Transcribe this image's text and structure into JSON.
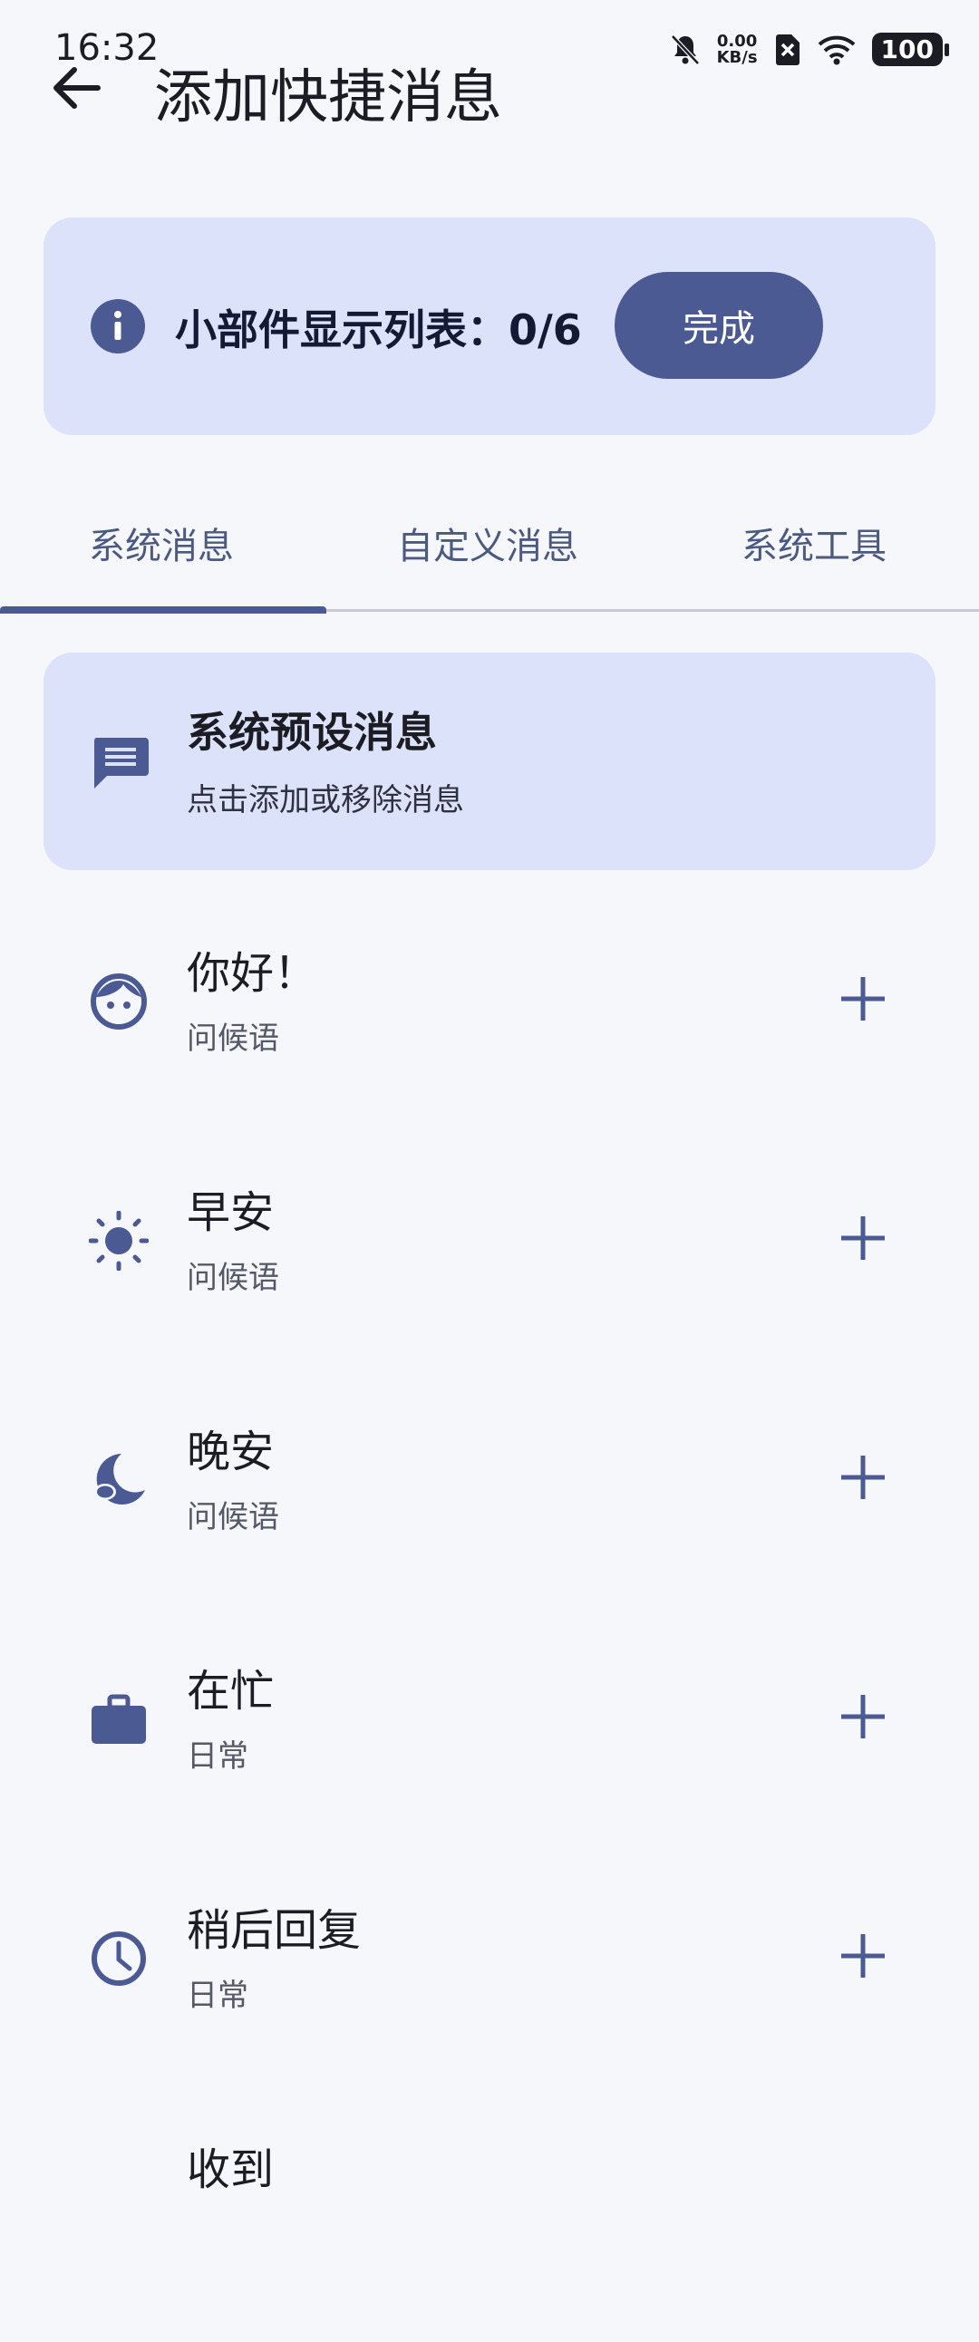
{
  "status_bar": {
    "time": "16:32",
    "net_speed_value": "0.00",
    "net_speed_unit": "KB/s",
    "battery": "100"
  },
  "app_bar": {
    "title": "添加快捷消息"
  },
  "widget_card": {
    "count_text": "小部件显示列表：0/6",
    "done_label": "完成"
  },
  "tabs": [
    {
      "label": "系统消息",
      "active": true
    },
    {
      "label": "自定义消息",
      "active": false
    },
    {
      "label": "系统工具",
      "active": false
    }
  ],
  "section": {
    "title": "系统预设消息",
    "subtitle": "点击添加或移除消息"
  },
  "messages": [
    {
      "title": "你好！",
      "category": "问候语",
      "icon": "face-icon"
    },
    {
      "title": "早安",
      "category": "问候语",
      "icon": "sun-icon"
    },
    {
      "title": "晚安",
      "category": "问候语",
      "icon": "moon-icon"
    },
    {
      "title": "在忙",
      "category": "日常",
      "icon": "briefcase-icon"
    },
    {
      "title": "稍后回复",
      "category": "日常",
      "icon": "clock-icon"
    },
    {
      "title": "收到",
      "category": "",
      "icon": ""
    }
  ],
  "colors": {
    "accent": "#4c5a93",
    "card": "#dde2fb",
    "background": "#f6f7fb"
  }
}
